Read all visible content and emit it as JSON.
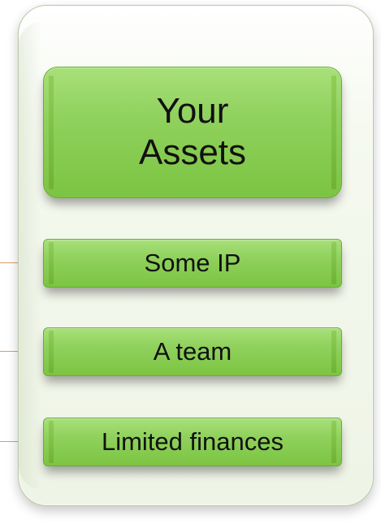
{
  "assets_panel": {
    "title": "Your\nAssets",
    "items": [
      {
        "label": "Some IP"
      },
      {
        "label": "A team"
      },
      {
        "label": "Limited finances"
      }
    ]
  },
  "colors": {
    "box_fill": "#8fd15c",
    "box_border": "#6cab39",
    "panel_fill": "#eef4e6",
    "connector": "#d9a066",
    "text": "#111111"
  }
}
